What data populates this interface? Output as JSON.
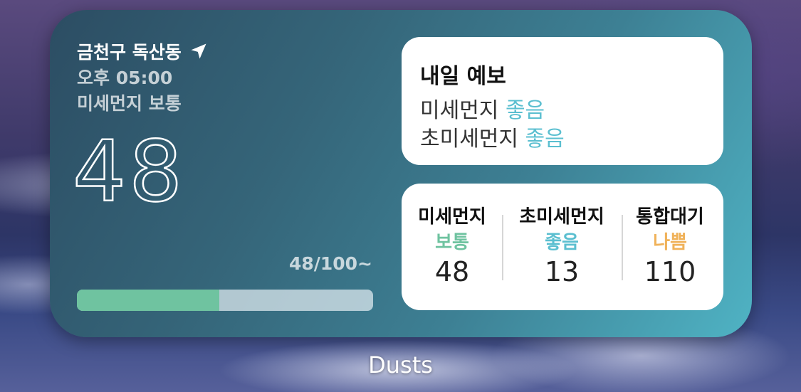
{
  "widget": {
    "location": "금천구 독산동",
    "location_icon": "location-arrow-icon",
    "time": "오후 05:00",
    "status": "미세먼지 보통",
    "value": "48",
    "range_label": "48/100~",
    "progress_fraction": 0.48,
    "colors": {
      "good": "#5bbfd0",
      "normal": "#6fc3a0",
      "bad": "#f0b25a"
    }
  },
  "forecast": {
    "title": "내일 예보",
    "rows": [
      {
        "label": "미세먼지",
        "grade": "좋음"
      },
      {
        "label": "초미세먼지",
        "grade": "좋음"
      }
    ]
  },
  "detail": {
    "columns": [
      {
        "label": "미세먼지",
        "grade": "보통",
        "value": "48",
        "grade_color": "#6fc3a0"
      },
      {
        "label": "초미세먼지",
        "grade": "좋음",
        "value": "13",
        "grade_color": "#5bbfd0"
      },
      {
        "label": "통합대기",
        "grade": "나쁨",
        "value": "110",
        "grade_color": "#f0b25a"
      }
    ]
  },
  "app_label": "Dusts"
}
